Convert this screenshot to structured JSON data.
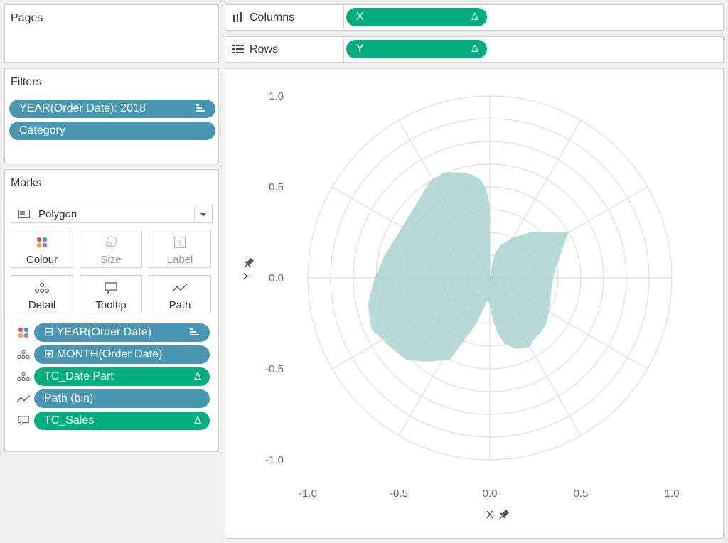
{
  "pages": {
    "title": "Pages"
  },
  "filters": {
    "title": "Filters",
    "items": [
      {
        "label": "YEAR(Order Date): 2018",
        "sorted": true
      },
      {
        "label": "Category",
        "sorted": false
      }
    ]
  },
  "marks": {
    "title": "Marks",
    "mark_type": "Polygon",
    "buttons": [
      {
        "label": "Colour",
        "enabled": true
      },
      {
        "label": "Size",
        "enabled": false
      },
      {
        "label": "Label",
        "enabled": false
      },
      {
        "label": "Detail",
        "enabled": true
      },
      {
        "label": "Tooltip",
        "enabled": true
      },
      {
        "label": "Path",
        "enabled": true
      }
    ],
    "fields": [
      {
        "encoding": "colour",
        "label": "⊟ YEAR(Order Date)",
        "color": "blue",
        "end": "sort"
      },
      {
        "encoding": "detail",
        "label": "⊞ MONTH(Order Date)",
        "color": "blue",
        "end": ""
      },
      {
        "encoding": "detail",
        "label": "TC_Date Part",
        "color": "green",
        "end": "Δ"
      },
      {
        "encoding": "path",
        "label": "Path (bin)",
        "color": "blue",
        "end": ""
      },
      {
        "encoding": "tooltip",
        "label": "TC_Sales",
        "color": "green",
        "end": "Δ"
      }
    ]
  },
  "shelves": {
    "columns": {
      "label": "Columns",
      "field": "X",
      "icon": "Δ"
    },
    "rows": {
      "label": "Rows",
      "field": "Y",
      "icon": "Δ"
    }
  },
  "colors": {
    "blue_pill": "#4a97b3",
    "green_pill": "#00ad7f",
    "polygon_fill": "#a8d3d1",
    "grid": "#dcdcdc"
  },
  "chart_data": {
    "type": "area",
    "xlabel": "X",
    "ylabel": "Y",
    "xlim": [
      -1.0,
      1.0
    ],
    "ylim": [
      -1.0,
      1.0
    ],
    "x_ticks": [
      "-1.0",
      "-0.5",
      "0.0",
      "0.5",
      "1.0"
    ],
    "y_ticks": [
      "1.0",
      "0.5",
      "0.0",
      "-0.5",
      "-1.0"
    ],
    "grid": true,
    "radial_rings": [
      0.125,
      0.25,
      0.375,
      0.5,
      0.625,
      0.75,
      0.875,
      1.0
    ],
    "spoke_angles_deg": [
      0,
      30,
      60,
      90,
      120,
      150,
      180,
      210,
      240,
      270,
      300,
      330
    ],
    "polygon": {
      "x": [
        0.0,
        0.01,
        0.03,
        0.06,
        0.12,
        0.22,
        0.34,
        0.43,
        0.4,
        0.35,
        0.34,
        0.33,
        0.31,
        0.28,
        0.24,
        0.22,
        0.14,
        0.08,
        0.04,
        0.02,
        -0.01,
        -0.08,
        -0.22,
        -0.32,
        -0.37,
        -0.46,
        -0.57,
        -0.65,
        -0.67,
        -0.64,
        -0.58,
        -0.5,
        -0.42,
        -0.33,
        -0.25,
        -0.17,
        -0.1,
        -0.05,
        -0.02,
        0.0
      ],
      "y": [
        0.0,
        0.06,
        0.14,
        0.18,
        0.22,
        0.25,
        0.25,
        0.25,
        0.16,
        0.01,
        -0.05,
        -0.15,
        -0.25,
        -0.3,
        -0.34,
        -0.38,
        -0.39,
        -0.36,
        -0.3,
        -0.24,
        -0.12,
        -0.26,
        -0.45,
        -0.46,
        -0.46,
        -0.45,
        -0.36,
        -0.28,
        -0.15,
        -0.02,
        0.12,
        0.25,
        0.38,
        0.53,
        0.58,
        0.58,
        0.57,
        0.54,
        0.49,
        0.4
      ]
    }
  }
}
